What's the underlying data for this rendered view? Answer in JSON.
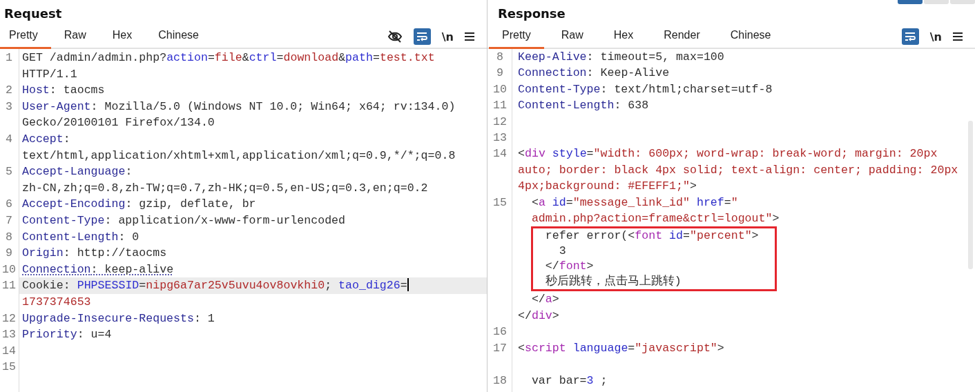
{
  "request": {
    "title": "Request",
    "tabs": [
      {
        "label": "Pretty",
        "selected": true
      },
      {
        "label": "Raw",
        "selected": false
      },
      {
        "label": "Hex",
        "selected": false
      },
      {
        "label": "Chinese",
        "selected": false
      }
    ],
    "tools": [
      {
        "kind": "hide"
      },
      {
        "kind": "wrap",
        "on": true
      },
      {
        "kind": "newline",
        "label": "\\n"
      },
      {
        "kind": "menu"
      }
    ],
    "lines": [
      {
        "number": "1",
        "selected": false,
        "rows": [
          {
            "kind": "code",
            "tokens": [
              {
                "kind": "plain",
                "text": "GET /admin/admin.php?"
              },
              {
                "kind": "param",
                "text": "action"
              },
              {
                "kind": "plain",
                "text": "="
              },
              {
                "kind": "value",
                "text": "file"
              },
              {
                "kind": "plain",
                "text": "&"
              },
              {
                "kind": "param",
                "text": "ctrl"
              },
              {
                "kind": "plain",
                "text": "="
              },
              {
                "kind": "value",
                "text": "download"
              },
              {
                "kind": "plain",
                "text": "&"
              },
              {
                "kind": "param",
                "text": "path"
              },
              {
                "kind": "plain",
                "text": "="
              },
              {
                "kind": "value",
                "text": "test.txt"
              }
            ]
          },
          {
            "kind": "code",
            "tokens": [
              {
                "kind": "plain",
                "text": "HTTP/1.1"
              }
            ]
          }
        ]
      },
      {
        "number": "2",
        "selected": false,
        "rows": [
          {
            "kind": "code",
            "tokens": [
              {
                "kind": "key",
                "text": "Host"
              },
              {
                "kind": "plain",
                "text": ": taocms"
              }
            ]
          }
        ]
      },
      {
        "number": "3",
        "selected": false,
        "rows": [
          {
            "kind": "code",
            "tokens": [
              {
                "kind": "key",
                "text": "User-Agent"
              },
              {
                "kind": "plain",
                "text": ": Mozilla/5.0 (Windows NT 10.0; Win64; x64; rv:134.0)"
              }
            ]
          },
          {
            "kind": "code",
            "tokens": [
              {
                "kind": "plain",
                "text": "Gecko/20100101 Firefox/134.0"
              }
            ]
          }
        ]
      },
      {
        "number": "4",
        "selected": false,
        "rows": [
          {
            "kind": "code",
            "tokens": [
              {
                "kind": "key",
                "text": "Accept"
              },
              {
                "kind": "plain",
                "text": ":"
              }
            ]
          },
          {
            "kind": "code",
            "tokens": [
              {
                "kind": "plain",
                "text": "text/html,application/xhtml+xml,application/xml;q=0.9,*/*;q=0.8"
              }
            ]
          }
        ]
      },
      {
        "number": "5",
        "selected": false,
        "rows": [
          {
            "kind": "code",
            "tokens": [
              {
                "kind": "key",
                "text": "Accept-Language"
              },
              {
                "kind": "plain",
                "text": ":"
              }
            ]
          },
          {
            "kind": "code",
            "tokens": [
              {
                "kind": "plain",
                "text": "zh-CN,zh;q=0.8,zh-TW;q=0.7,zh-HK;q=0.5,en-US;q=0.3,en;q=0.2"
              }
            ]
          }
        ]
      },
      {
        "number": "6",
        "selected": false,
        "rows": [
          {
            "kind": "code",
            "tokens": [
              {
                "kind": "key",
                "text": "Accept-Encoding"
              },
              {
                "kind": "plain",
                "text": ": gzip, deflate, br"
              }
            ]
          }
        ]
      },
      {
        "number": "7",
        "selected": false,
        "rows": [
          {
            "kind": "code",
            "tokens": [
              {
                "kind": "key",
                "text": "Content-Type"
              },
              {
                "kind": "plain",
                "text": ": application/x-www-form-urlencoded"
              }
            ]
          }
        ]
      },
      {
        "number": "8",
        "selected": false,
        "rows": [
          {
            "kind": "code",
            "tokens": [
              {
                "kind": "key",
                "text": "Content-Length"
              },
              {
                "kind": "plain",
                "text": ": 0"
              }
            ]
          }
        ]
      },
      {
        "number": "9",
        "selected": false,
        "rows": [
          {
            "kind": "code",
            "tokens": [
              {
                "kind": "key",
                "text": "Origin"
              },
              {
                "kind": "plain",
                "text": ": http://taocms"
              }
            ]
          }
        ]
      },
      {
        "number": "10",
        "selected": false,
        "rows": [
          {
            "kind": "flagged",
            "tokens": [
              {
                "kind": "key",
                "text": "Connection"
              },
              {
                "kind": "plain",
                "text": ": keep-alive"
              }
            ]
          }
        ]
      },
      {
        "number": "11",
        "selected": true,
        "rows": [
          {
            "kind": "code",
            "tokens": [
              {
                "kind": "plain",
                "text": "Cookie: "
              },
              {
                "kind": "param",
                "text": "PHPSESSID"
              },
              {
                "kind": "plain",
                "text": "="
              },
              {
                "kind": "value",
                "text": "nipg6a7ar25v5uvu4ov8ovkhi0"
              },
              {
                "kind": "plain",
                "text": "; "
              },
              {
                "kind": "param",
                "text": "tao_dig26"
              },
              {
                "kind": "plain",
                "text": "="
              },
              {
                "kind": "caret"
              }
            ]
          },
          {
            "kind": "code",
            "tokens": [
              {
                "kind": "value",
                "text": "1737374653"
              }
            ]
          }
        ]
      },
      {
        "number": "12",
        "selected": false,
        "rows": [
          {
            "kind": "code",
            "tokens": [
              {
                "kind": "key",
                "text": "Upgrade-Insecure-Requests"
              },
              {
                "kind": "plain",
                "text": ": 1"
              }
            ]
          }
        ]
      },
      {
        "number": "13",
        "selected": false,
        "rows": [
          {
            "kind": "code",
            "tokens": [
              {
                "kind": "key",
                "text": "Priority"
              },
              {
                "kind": "plain",
                "text": ": u=4"
              }
            ]
          }
        ]
      },
      {
        "number": "14",
        "selected": false,
        "rows": [
          {
            "kind": "code",
            "tokens": []
          }
        ]
      },
      {
        "number": "15",
        "selected": false,
        "rows": [
          {
            "kind": "code",
            "tokens": []
          }
        ]
      }
    ]
  },
  "response": {
    "title": "Response",
    "tabs": [
      {
        "label": "Pretty",
        "selected": true
      },
      {
        "label": "Raw",
        "selected": false
      },
      {
        "label": "Hex",
        "selected": false
      },
      {
        "label": "Render",
        "selected": false
      },
      {
        "label": "Chinese",
        "selected": false
      }
    ],
    "tools": [
      {
        "kind": "wrap",
        "on": true
      },
      {
        "kind": "newline",
        "label": "\\n"
      },
      {
        "kind": "menu"
      }
    ],
    "lines": [
      {
        "number": "8",
        "selected": false,
        "rows": [
          {
            "kind": "code",
            "tokens": [
              {
                "kind": "key",
                "text": "Keep-Alive"
              },
              {
                "kind": "plain",
                "text": ": timeout=5, max=100"
              }
            ]
          }
        ]
      },
      {
        "number": "9",
        "selected": false,
        "rows": [
          {
            "kind": "code",
            "tokens": [
              {
                "kind": "key",
                "text": "Connection"
              },
              {
                "kind": "plain",
                "text": ": Keep-Alive"
              }
            ]
          }
        ]
      },
      {
        "number": "10",
        "selected": false,
        "rows": [
          {
            "kind": "code",
            "tokens": [
              {
                "kind": "key",
                "text": "Content-Type"
              },
              {
                "kind": "plain",
                "text": ": text/html;charset=utf-8"
              }
            ]
          }
        ]
      },
      {
        "number": "11",
        "selected": false,
        "rows": [
          {
            "kind": "code",
            "tokens": [
              {
                "kind": "key",
                "text": "Content-Length"
              },
              {
                "kind": "plain",
                "text": ": 638"
              }
            ]
          }
        ]
      },
      {
        "number": "12",
        "selected": false,
        "rows": [
          {
            "kind": "code",
            "tokens": []
          }
        ]
      },
      {
        "number": "13",
        "selected": false,
        "rows": [
          {
            "kind": "code",
            "tokens": []
          }
        ]
      },
      {
        "number": "14",
        "selected": false,
        "rows": [
          {
            "kind": "code",
            "tokens": [
              {
                "kind": "plain",
                "text": "<"
              },
              {
                "kind": "tag",
                "text": "div"
              },
              {
                "kind": "attr",
                "text": " style"
              },
              {
                "kind": "plain",
                "text": "="
              },
              {
                "kind": "value",
                "text": "\"width: 600px; word-wrap: break-word; margin: 20px"
              }
            ]
          },
          {
            "kind": "code",
            "tokens": [
              {
                "kind": "value",
                "text": "auto; border: black 4px solid; text-align: center; padding: 20px"
              }
            ]
          },
          {
            "kind": "code",
            "tokens": [
              {
                "kind": "value",
                "text": "4px;background: #EFEFF1;\""
              },
              {
                "kind": "plain",
                "text": ">"
              }
            ]
          }
        ]
      },
      {
        "number": "15",
        "selected": false,
        "rows": [
          {
            "kind": "code",
            "tokens": [
              {
                "kind": "plain",
                "text": "  <"
              },
              {
                "kind": "tag",
                "text": "a"
              },
              {
                "kind": "attr",
                "text": " id"
              },
              {
                "kind": "plain",
                "text": "="
              },
              {
                "kind": "value",
                "text": "\"message_link_id\""
              },
              {
                "kind": "attr",
                "text": " href"
              },
              {
                "kind": "plain",
                "text": "="
              },
              {
                "kind": "value",
                "text": "\""
              }
            ]
          },
          {
            "kind": "code",
            "tokens": [
              {
                "kind": "value",
                "text": "  admin.php?action=frame&ctrl=logout\""
              },
              {
                "kind": "plain",
                "text": ">"
              }
            ]
          },
          {
            "kind": "box",
            "rows": [
              {
                "kind": "code",
                "tokens": [
                  {
                    "kind": "plain",
                    "text": "    refer error("
                  },
                  {
                    "kind": "plain",
                    "text": "<"
                  },
                  {
                    "kind": "tag",
                    "text": "font"
                  },
                  {
                    "kind": "attr",
                    "text": " id"
                  },
                  {
                    "kind": "plain",
                    "text": "="
                  },
                  {
                    "kind": "value",
                    "text": "\"percent\""
                  },
                  {
                    "kind": "plain",
                    "text": ">"
                  }
                ]
              },
              {
                "kind": "code",
                "tokens": [
                  {
                    "kind": "plain",
                    "text": "      3"
                  }
                ]
              },
              {
                "kind": "code",
                "tokens": [
                  {
                    "kind": "plain",
                    "text": "    </"
                  },
                  {
                    "kind": "tag",
                    "text": "font"
                  },
                  {
                    "kind": "plain",
                    "text": ">"
                  }
                ]
              },
              {
                "kind": "code",
                "tokens": [
                  {
                    "kind": "plain",
                    "text": "    秒后跳转，点击马上跳转)"
                  }
                ]
              }
            ]
          },
          {
            "kind": "code",
            "tokens": [
              {
                "kind": "plain",
                "text": "  </"
              },
              {
                "kind": "tag",
                "text": "a"
              },
              {
                "kind": "plain",
                "text": ">"
              }
            ]
          },
          {
            "kind": "code",
            "tokens": [
              {
                "kind": "plain",
                "text": "</"
              },
              {
                "kind": "tag",
                "text": "div"
              },
              {
                "kind": "plain",
                "text": ">"
              }
            ]
          }
        ]
      },
      {
        "number": "16",
        "selected": false,
        "rows": [
          {
            "kind": "code",
            "tokens": []
          }
        ]
      },
      {
        "number": "17",
        "selected": false,
        "rows": [
          {
            "kind": "code",
            "tokens": [
              {
                "kind": "plain",
                "text": "<"
              },
              {
                "kind": "tag",
                "text": "script"
              },
              {
                "kind": "attr",
                "text": " language"
              },
              {
                "kind": "plain",
                "text": "="
              },
              {
                "kind": "value",
                "text": "\"javascript\""
              },
              {
                "kind": "plain",
                "text": ">"
              }
            ]
          },
          {
            "kind": "code",
            "tokens": []
          }
        ]
      },
      {
        "number": "18",
        "selected": false,
        "rows": [
          {
            "kind": "code",
            "tokens": [
              {
                "kind": "plain",
                "text": "  var bar="
              },
              {
                "kind": "num",
                "text": "3"
              },
              {
                "kind": "plain",
                "text": " ;"
              }
            ]
          }
        ]
      }
    ]
  }
}
